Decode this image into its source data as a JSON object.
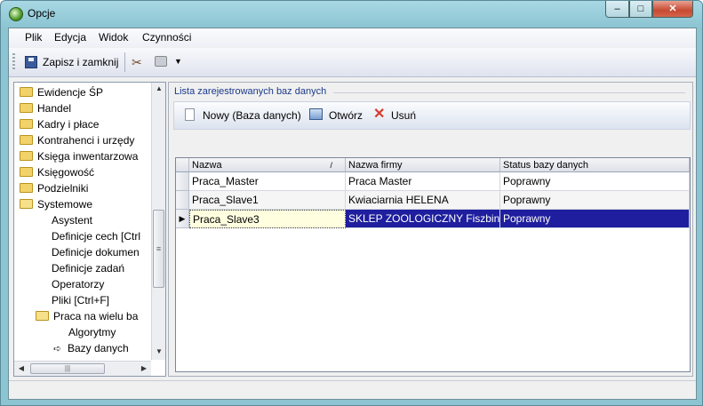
{
  "window": {
    "title": "Opcje"
  },
  "menu": [
    "Plik",
    "Edycja",
    "Widok",
    "Czynności"
  ],
  "toolbar": {
    "save_label": "Zapisz i zamknij"
  },
  "tree": {
    "items": [
      {
        "label": "Ewidencje ŚP",
        "type": "folder"
      },
      {
        "label": "Handel",
        "type": "folder"
      },
      {
        "label": "Kadry i płace",
        "type": "folder"
      },
      {
        "label": "Kontrahenci i urzędy",
        "type": "folder"
      },
      {
        "label": "Księga inwentarzowa",
        "type": "folder"
      },
      {
        "label": "Księgowość",
        "type": "folder"
      },
      {
        "label": "Podzielniki",
        "type": "folder"
      },
      {
        "label": "Systemowe",
        "type": "folder-open"
      },
      {
        "label": "Asystent",
        "type": "leaf"
      },
      {
        "label": "Definicje cech [Ctrl",
        "type": "leaf"
      },
      {
        "label": "Definicje dokumen",
        "type": "leaf"
      },
      {
        "label": "Definicje zadań",
        "type": "leaf"
      },
      {
        "label": "Operatorzy",
        "type": "leaf"
      },
      {
        "label": "Pliki [Ctrl+F]",
        "type": "leaf"
      },
      {
        "label": "Praca na wielu ba",
        "type": "folder-open"
      },
      {
        "label": "Algorytmy",
        "type": "leaf"
      },
      {
        "label": "Bazy danych",
        "type": "current"
      }
    ]
  },
  "panel": {
    "group_title": "Lista zarejestrowanych baz danych",
    "actions": {
      "new": "Nowy (Baza danych)",
      "open": "Otwórz",
      "delete": "Usuń"
    },
    "columns": [
      "Nazwa",
      "Nazwa firmy",
      "Status bazy danych"
    ],
    "rows": [
      [
        "Praca_Master",
        "Praca Master",
        "Poprawny"
      ],
      [
        "Praca_Slave1",
        "Kwiaciarnia HELENA",
        "Poprawny"
      ],
      [
        "Praca_Slave3",
        "SKLEP ZOOLOGICZNY Fiszbin",
        "Poprawny"
      ]
    ],
    "selected_row": 2
  }
}
